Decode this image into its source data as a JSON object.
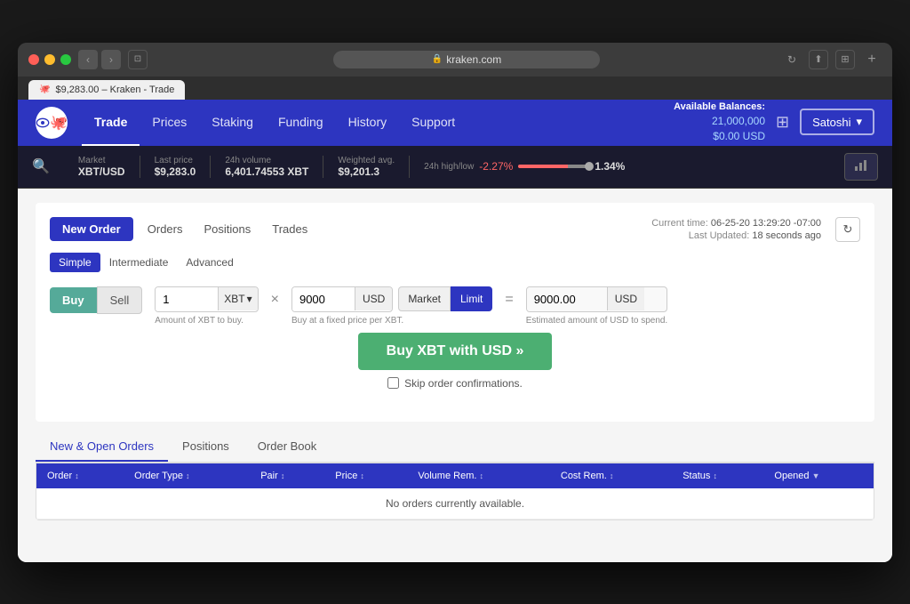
{
  "browser": {
    "url": "kraken.com",
    "tab_title": "$9,283.00 – Kraken - Trade",
    "back_label": "‹",
    "forward_label": "›"
  },
  "nav": {
    "logo_symbol": "🐙",
    "links": [
      {
        "label": "Trade",
        "active": true
      },
      {
        "label": "Prices",
        "active": false
      },
      {
        "label": "Staking",
        "active": false
      },
      {
        "label": "Funding",
        "active": false
      },
      {
        "label": "History",
        "active": false
      },
      {
        "label": "Support",
        "active": false
      }
    ],
    "balances_label": "Available Balances:",
    "balance_crypto": "21,000,000",
    "balance_usd": "$0.00 USD",
    "user_label": "Satoshi"
  },
  "market_bar": {
    "pair": "XBT/USD",
    "market_label": "Market",
    "last_price_label": "Last price",
    "last_price": "$9,283.0",
    "volume_label": "24h volume",
    "volume": "6,401.74553 XBT",
    "weighted_label": "Weighted avg.",
    "weighted": "$9,201.3",
    "change_label": "24h high/low",
    "change_value": "-2.27%",
    "high_low": "1.34%"
  },
  "order_form": {
    "tab_new_order": "New Order",
    "tab_orders": "Orders",
    "tab_positions": "Positions",
    "tab_trades": "Trades",
    "current_time_label": "Current time:",
    "current_time": "06-25-20 13:29:20 -07:00",
    "last_updated_label": "Last Updated:",
    "last_updated": "18 seconds ago",
    "mode_simple": "Simple",
    "mode_intermediate": "Intermediate",
    "mode_advanced": "Advanced",
    "buy_label": "Buy",
    "sell_label": "Sell",
    "amount_value": "1",
    "amount_currency": "XBT",
    "multiply_sign": "×",
    "price_value": "9000",
    "price_currency": "USD",
    "market_label": "Market",
    "limit_label": "Limit",
    "equals_sign": "=",
    "total_value": "9000.00",
    "total_currency": "USD",
    "amount_helper": "Amount of XBT to buy.",
    "price_helper": "Buy at a fixed price per XBT.",
    "total_helper": "Estimated amount of USD to spend.",
    "buy_action_label": "Buy XBT with USD »",
    "skip_confirm_label": "Skip order confirmations."
  },
  "bottom": {
    "tab_open_orders": "New & Open Orders",
    "tab_positions": "Positions",
    "tab_order_book": "Order Book",
    "table_headers": [
      {
        "label": "Order",
        "sort": "↕"
      },
      {
        "label": "Order Type",
        "sort": "↕"
      },
      {
        "label": "Pair",
        "sort": "↕"
      },
      {
        "label": "Price",
        "sort": "↕"
      },
      {
        "label": "Volume Rem.",
        "sort": "↕"
      },
      {
        "label": "Cost Rem.",
        "sort": "↕"
      },
      {
        "label": "Status",
        "sort": "↕"
      },
      {
        "label": "Opened",
        "sort": "▼"
      }
    ],
    "empty_message": "No orders currently available."
  }
}
